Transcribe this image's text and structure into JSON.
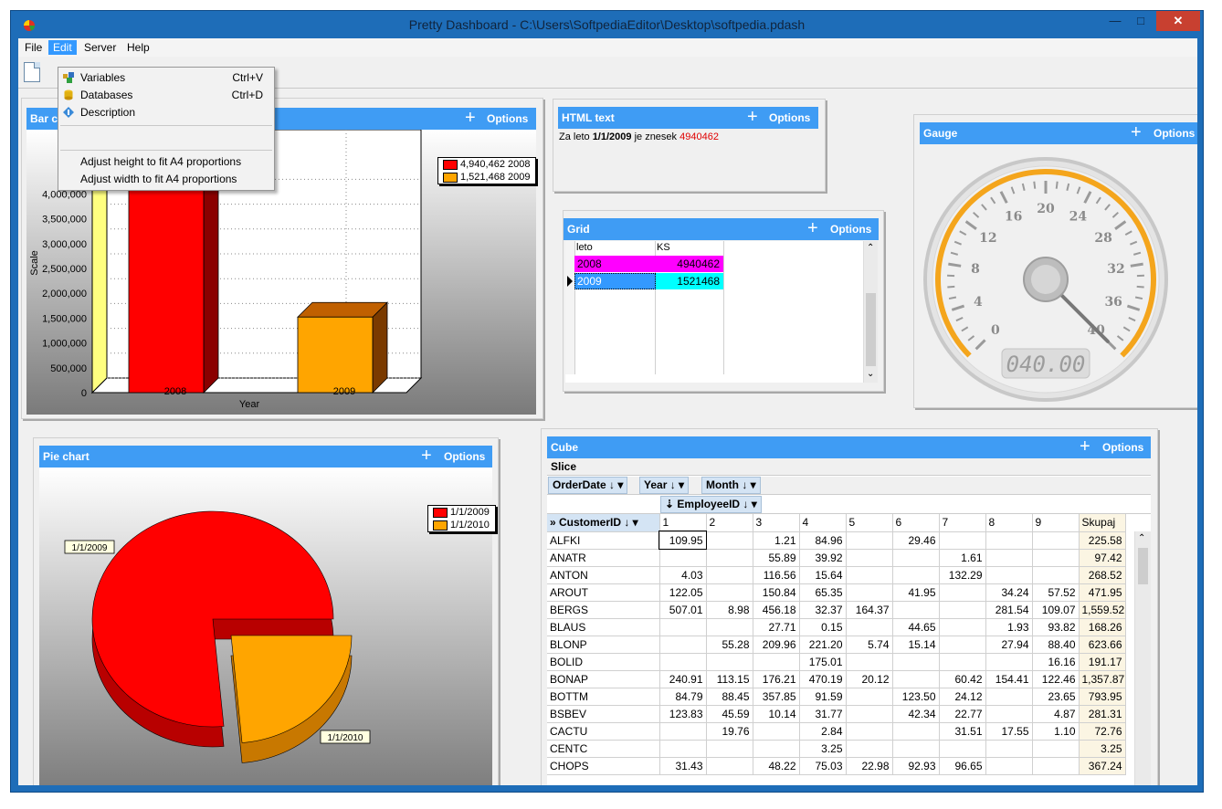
{
  "window": {
    "title": "Pretty Dashboard - C:\\Users\\SoftpediaEditor\\Desktop\\softpedia.pdash"
  },
  "menu": {
    "items": [
      "File",
      "Edit",
      "Server",
      "Help"
    ]
  },
  "edit_menu": {
    "items": [
      {
        "label": "Variables",
        "shortcut": "Ctrl+V",
        "icon": "variables-icon"
      },
      {
        "label": "Databases",
        "shortcut": "Ctrl+D",
        "icon": "database-icon"
      },
      {
        "label": "Description",
        "shortcut": "",
        "icon": "description-icon"
      },
      {
        "label": "Adjust height to fit A4 proportions",
        "shortcut": ""
      },
      {
        "label": "Adjust width to fit A4 proportions",
        "shortcut": ""
      }
    ]
  },
  "common": {
    "options_label": "Options",
    "plus": "+"
  },
  "bar_panel": {
    "title": "Bar c",
    "chart_data": {
      "type": "bar",
      "categories": [
        "2008",
        "2009"
      ],
      "values": [
        4940462,
        1521468
      ],
      "xlabel": "Year",
      "ylabel": "Scale",
      "yticks": [
        "0",
        "500,000",
        "1,000,000",
        "1,500,000",
        "2,000,000",
        "2,500,000",
        "3,000,000",
        "3,500,000",
        "4,000,000"
      ],
      "ylim": [
        0,
        5000000
      ],
      "colors": [
        "#ff0000",
        "#ffa500"
      ],
      "legend": [
        "4,940,462 2008",
        "1,521,468 2009"
      ],
      "legend_position": "top-right",
      "grid": true
    }
  },
  "html_panel": {
    "title": "HTML text",
    "text_prefix": "Za leto ",
    "text_bold": "1/1/2009",
    "text_mid": " je znesek ",
    "text_value": "4940462"
  },
  "grid_panel": {
    "title": "Grid",
    "columns": [
      "leto",
      "KS"
    ],
    "rows": [
      [
        "2008",
        "4940462"
      ],
      [
        "2009",
        "1521468"
      ]
    ],
    "row_colors": [
      "#ff00ff",
      "#00ffff"
    ]
  },
  "gauge_panel": {
    "title": "Gauge",
    "ticks": [
      "0",
      "4",
      "8",
      "12",
      "16",
      "20",
      "24",
      "28",
      "32",
      "36",
      "40"
    ],
    "readout": "040.00",
    "value": 40,
    "max": 40
  },
  "pie_panel": {
    "title": "Pie chart",
    "chart_data": {
      "type": "pie",
      "labels": [
        "1/1/2009",
        "1/1/2010"
      ],
      "values": [
        4940462,
        1521468
      ],
      "colors": [
        "#ff0000",
        "#ffa500"
      ],
      "legend": [
        "1/1/2009",
        "1/1/2010"
      ],
      "legend_position": "top-right"
    }
  },
  "cube_panel": {
    "title": "Cube",
    "slice_label": "Slice",
    "filters": [
      "OrderDate",
      "Year",
      "Month"
    ],
    "column_field": "EmployeeID",
    "row_field": "CustomerID",
    "columns": [
      "1",
      "2",
      "3",
      "4",
      "5",
      "6",
      "7",
      "8",
      "9",
      "Skupaj"
    ],
    "rows": [
      [
        "ALFKI",
        "109.95",
        "",
        "1.21",
        "84.96",
        "",
        "29.46",
        "",
        "",
        "",
        "225.58"
      ],
      [
        "ANATR",
        "",
        "",
        "55.89",
        "39.92",
        "",
        "",
        "1.61",
        "",
        "",
        "97.42"
      ],
      [
        "ANTON",
        "4.03",
        "",
        "116.56",
        "15.64",
        "",
        "",
        "132.29",
        "",
        "",
        "268.52"
      ],
      [
        "AROUT",
        "122.05",
        "",
        "150.84",
        "65.35",
        "",
        "41.95",
        "",
        "34.24",
        "57.52",
        "471.95"
      ],
      [
        "BERGS",
        "507.01",
        "8.98",
        "456.18",
        "32.37",
        "164.37",
        "",
        "",
        "281.54",
        "109.07",
        "1,559.52"
      ],
      [
        "BLAUS",
        "",
        "",
        "27.71",
        "0.15",
        "",
        "44.65",
        "",
        "1.93",
        "93.82",
        "168.26"
      ],
      [
        "BLONP",
        "",
        "55.28",
        "209.96",
        "221.20",
        "5.74",
        "15.14",
        "",
        "27.94",
        "88.40",
        "623.66"
      ],
      [
        "BOLID",
        "",
        "",
        "",
        "175.01",
        "",
        "",
        "",
        "",
        "16.16",
        "191.17"
      ],
      [
        "BONAP",
        "240.91",
        "113.15",
        "176.21",
        "470.19",
        "20.12",
        "",
        "60.42",
        "154.41",
        "122.46",
        "1,357.87"
      ],
      [
        "BOTTM",
        "84.79",
        "88.45",
        "357.85",
        "91.59",
        "",
        "123.50",
        "24.12",
        "",
        "23.65",
        "793.95"
      ],
      [
        "BSBEV",
        "123.83",
        "45.59",
        "10.14",
        "31.77",
        "",
        "42.34",
        "22.77",
        "",
        "4.87",
        "281.31"
      ],
      [
        "CACTU",
        "",
        "19.76",
        "",
        "2.84",
        "",
        "",
        "31.51",
        "17.55",
        "1.10",
        "72.76"
      ],
      [
        "CENTC",
        "",
        "",
        "",
        "3.25",
        "",
        "",
        "",
        "",
        "",
        "3.25"
      ],
      [
        "CHOPS",
        "31.43",
        "",
        "48.22",
        "75.03",
        "22.98",
        "92.93",
        "96.65",
        "",
        "",
        "367.24"
      ]
    ]
  }
}
